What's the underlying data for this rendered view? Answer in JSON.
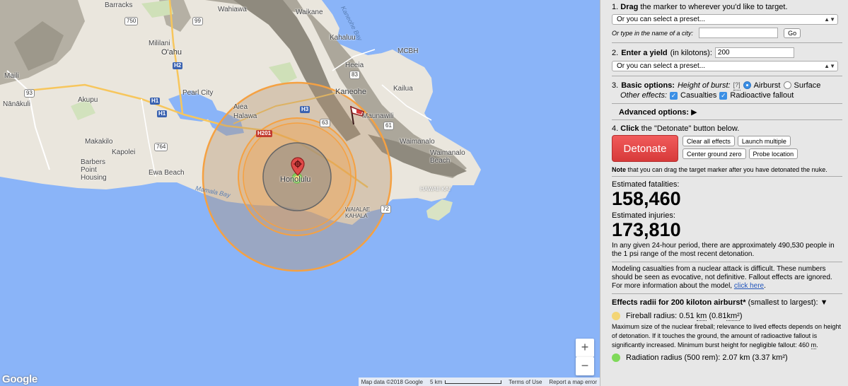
{
  "map": {
    "labels": {
      "barracks": "Barracks",
      "wahiawa": "Wahiawa",
      "waikane": "Waikane",
      "mililani": "Mililani",
      "oahu": "O'ahu",
      "kahaluu": "Kahaluu",
      "mcbh": "MCBH",
      "maili": "Maili",
      "heeia": "Heeia",
      "pearl_city": "Pearl City",
      "kaneohe": "Kaneohe",
      "kailua": "Kailua",
      "nanakuli": "Nānākuli",
      "akupu": "Akupu",
      "aiea": "Aiea",
      "halawa": "Halawa",
      "maunawili": "Maunawili",
      "makakilo": "Makakilo",
      "waimanalo": "Waimanalo",
      "kapolei": "Kapolei",
      "waimanalo_beach": "Waimanalo Beach",
      "barbers_point": "Barbers Point Housing",
      "ewa_beach": "Ewa Beach",
      "honolulu": "Honolulu",
      "hawaii_kai": "HAWAII KAI",
      "waialae_kahala": "WAIALAE KAHALA",
      "mamala_bay": "Mamala Bay",
      "kaneohe_bay": "Kaneohe Bay"
    },
    "shields": {
      "s750": "750",
      "s99": "99",
      "s93": "93",
      "s764": "764",
      "s63": "63",
      "s83": "83",
      "s61": "61",
      "s72": "72",
      "h2": "H2",
      "h1": "H1",
      "h3": "H3",
      "h201": "H201"
    },
    "zoom_in": "+",
    "zoom_out": "−",
    "google": "Google",
    "attribution": {
      "data": "Map data ©2018 Google",
      "scale": "5 km",
      "terms": "Terms of Use",
      "report": "Report a map error"
    },
    "colors": {
      "water": "#8ab4f8",
      "land": "#eae6dd",
      "mountain": "#a9a59a",
      "fireball": "#f6d15a",
      "radiation": "#7fd95a",
      "ring_orange": "#f5a142",
      "ring_gray": "#8b8b8b"
    }
  },
  "panel": {
    "step1": {
      "num": "1.",
      "bold": "Drag",
      "rest": "the marker to wherever you'd like to target.",
      "preset_placeholder": "Or you can select a preset...",
      "city_label": "Or type in the name of a city:",
      "city_value": "",
      "go": "Go"
    },
    "step2": {
      "num": "2.",
      "bold": "Enter a yield",
      "rest": "(in kilotons):",
      "yield_value": "200",
      "preset_placeholder": "Or you can select a preset..."
    },
    "step3": {
      "num": "3.",
      "bold": "Basic options:",
      "height_label": "Height of burst:",
      "help": "[?]",
      "airburst": "Airburst",
      "surface": "Surface",
      "other_label": "Other effects:",
      "casualties": "Casualties",
      "fallout": "Radioactive fallout",
      "advanced": "Advanced options:",
      "advanced_arrow": "▶"
    },
    "step4": {
      "num": "4.",
      "bold": "Click",
      "rest": "the \"Detonate\" button below.",
      "detonate": "Detonate",
      "clear": "Clear all effects",
      "launch": "Launch multiple",
      "center": "Center ground zero",
      "probe": "Probe location",
      "note_bold": "Note",
      "note_rest": "that you can drag the target marker after you have detonated the nuke."
    },
    "results": {
      "fatalities_label": "Estimated fatalities:",
      "fatalities": "158,460",
      "injuries_label": "Estimated injuries:",
      "injuries": "173,810",
      "period_text": "In any given 24-hour period, there are approximately 490,530 people in the 1 psi range of the most recent detonation.",
      "modeling_text": "Modeling casualties from a nuclear attack is difficult. These numbers should be seen as evocative, not definitive. Fallout effects are ignored. For more information about the model,",
      "click_here": "click here",
      "period_end": "."
    },
    "effects": {
      "header_bold": "Effects radii for 200 kiloton airburst*",
      "header_rest": "(smallest to largest):",
      "header_arrow": "▼",
      "fireball_label": "Fireball radius: 0.51",
      "fireball_km": "km",
      "fireball_area": "(0.81",
      "fireball_km2": "km²",
      "fireball_close": ")",
      "fireball_desc_a": "Maximum size of the nuclear fireball; relevance to lived effects depends on height of detonation. If it touches the ground, the amount of radioactive fallout is significantly increased. Minimum burst height for negligible fallout: 460",
      "fireball_desc_m": "m",
      "fireball_desc_end": ".",
      "radiation_label": "Radiation radius (500 rem): 2.07 km (3.37 km²)"
    }
  }
}
